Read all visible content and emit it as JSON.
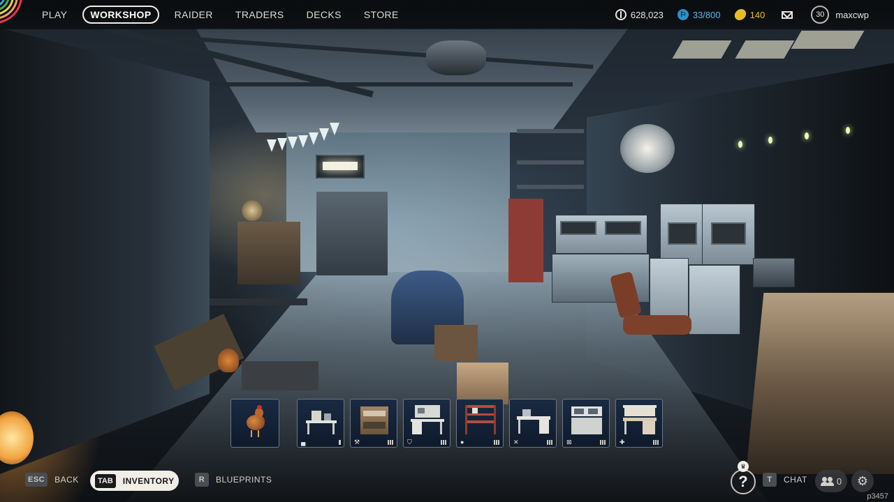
{
  "nav": {
    "items": [
      {
        "label": "PLAY",
        "active": false
      },
      {
        "label": "WORKSHOP",
        "active": true
      },
      {
        "label": "RAIDER",
        "active": false
      },
      {
        "label": "TRADERS",
        "active": false
      },
      {
        "label": "DECKS",
        "active": false
      },
      {
        "label": "STORE",
        "active": false
      }
    ]
  },
  "stats": {
    "coins": "628,023",
    "blueprints": "33/800",
    "gold": "140",
    "level": "30",
    "username": "maxcwp"
  },
  "hotbar": {
    "slots": [
      {
        "name": "chicken",
        "icon": "chicken-icon"
      },
      {
        "name": "workbench-1",
        "icon": "bench-icon"
      },
      {
        "name": "workbench-2",
        "icon": "hammer-icon"
      },
      {
        "name": "workbench-3",
        "icon": "shield-icon"
      },
      {
        "name": "workbench-4",
        "icon": "pill-icon"
      },
      {
        "name": "workbench-5",
        "icon": "tools-icon"
      },
      {
        "name": "workbench-6",
        "icon": "grenade-icon"
      },
      {
        "name": "workbench-7",
        "icon": "medkit-icon"
      }
    ]
  },
  "bottom": {
    "back": {
      "key": "ESC",
      "label": "BACK"
    },
    "inventory": {
      "key": "TAB",
      "label": "INVENTORY"
    },
    "blueprints": {
      "key": "R",
      "label": "BLUEPRINTS"
    },
    "help": "?",
    "chat": {
      "key": "T",
      "label": "CHAT"
    },
    "party_count": "0",
    "build_id": "p3457"
  },
  "colors": {
    "accent": "#f1eee7",
    "blueprint": "#2e8fc7",
    "gold": "#e7bd28",
    "slot_bg": "#1a2a42"
  }
}
